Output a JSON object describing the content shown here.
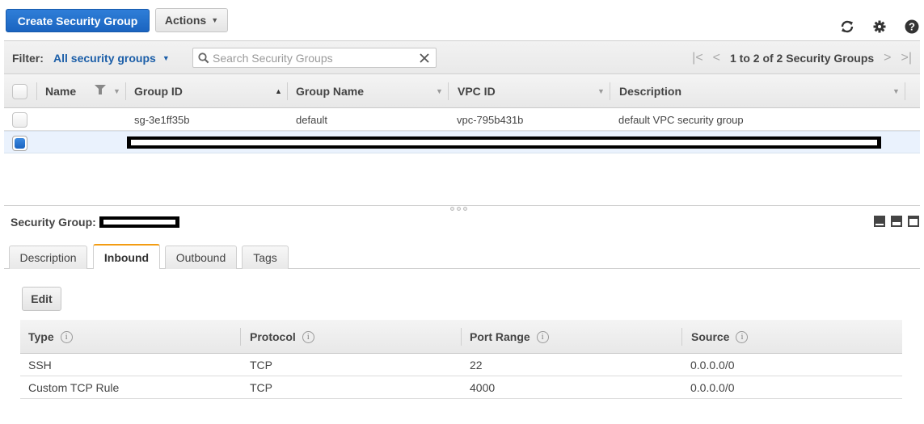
{
  "toolbar": {
    "create_label": "Create Security Group",
    "actions_label": "Actions",
    "icons": [
      "refresh-icon",
      "gear-icon",
      "help-icon"
    ]
  },
  "filter": {
    "label": "Filter:",
    "value": "All security groups",
    "search_placeholder": "Search Security Groups",
    "search_value": ""
  },
  "pager": {
    "count_text": "1 to 2 of 2 Security Groups"
  },
  "groups_table": {
    "columns": [
      "Name",
      "Group ID",
      "Group Name",
      "VPC ID",
      "Description"
    ],
    "sorted_column": "Group ID",
    "rows": [
      {
        "selected": false,
        "name": "",
        "group_id": "sg-3e1ff35b",
        "group_name": "default",
        "vpc_id": "vpc-795b431b",
        "description": "default VPC security group"
      },
      {
        "selected": true,
        "redacted": true
      }
    ]
  },
  "details": {
    "title": "Security Group:",
    "title_value_redacted": true,
    "tabs": [
      {
        "label": "Description",
        "active": false
      },
      {
        "label": "Inbound",
        "active": true
      },
      {
        "label": "Outbound",
        "active": false
      },
      {
        "label": "Tags",
        "active": false
      }
    ],
    "edit_label": "Edit",
    "rules_columns": [
      "Type",
      "Protocol",
      "Port Range",
      "Source"
    ],
    "rules": [
      {
        "type": "SSH",
        "protocol": "TCP",
        "port_range": "22",
        "source": "0.0.0.0/0"
      },
      {
        "type": "Custom TCP Rule",
        "protocol": "TCP",
        "port_range": "4000",
        "source": "0.0.0.0/0"
      }
    ]
  },
  "colors": {
    "primary": "#1a64c0",
    "link": "#1b5ea8",
    "active_tab_accent": "#f39c12",
    "selected_row": "#eaf2fd"
  }
}
